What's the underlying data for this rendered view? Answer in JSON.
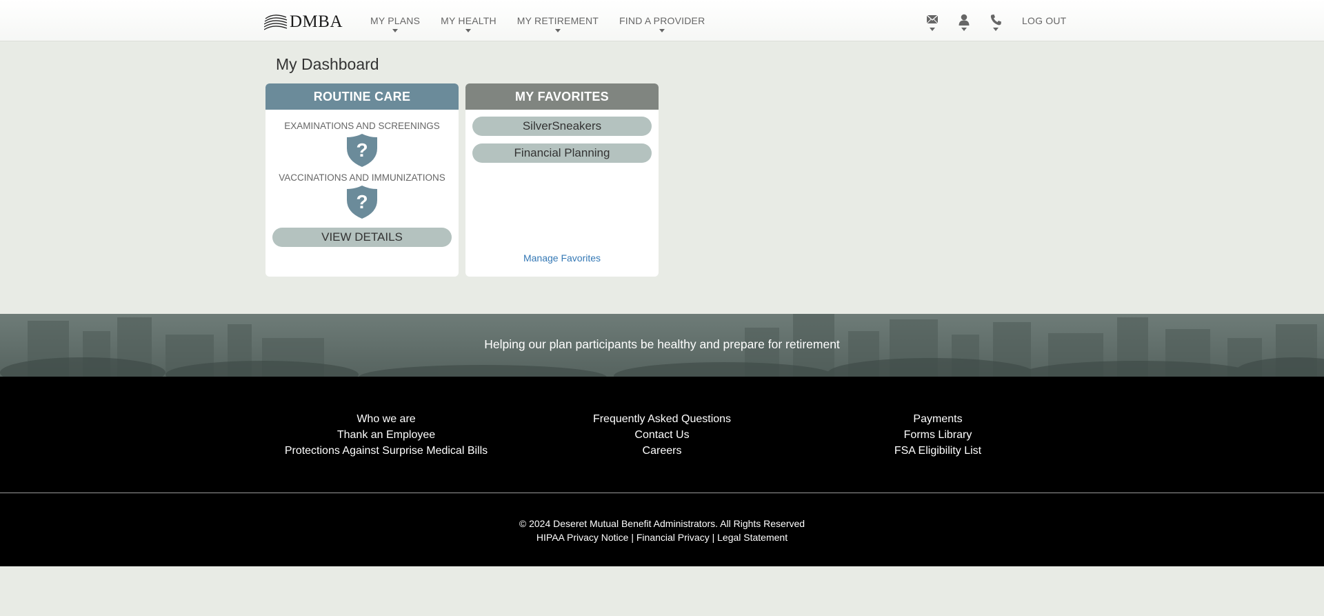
{
  "brand": {
    "name": "DMBA"
  },
  "nav": {
    "items": [
      {
        "label": "MY PLANS"
      },
      {
        "label": "MY HEALTH"
      },
      {
        "label": "MY RETIREMENT"
      },
      {
        "label": "FIND A PROVIDER"
      }
    ],
    "utilities": [
      "mail-icon",
      "user-icon",
      "phone-icon"
    ],
    "logout": "LOG OUT"
  },
  "main": {
    "title": "My Dashboard",
    "routine_care": {
      "heading": "ROUTINE CARE",
      "items": [
        {
          "label": "EXAMINATIONS AND SCREENINGS",
          "status_icon": "question-shield-icon"
        },
        {
          "label": "VACCINATIONS AND IMMUNIZATIONS",
          "status_icon": "question-shield-icon"
        }
      ],
      "button": "VIEW DETAILS"
    },
    "favorites": {
      "heading": "MY FAVORITES",
      "items": [
        {
          "label": "SilverSneakers"
        },
        {
          "label": "Financial Planning"
        }
      ],
      "manage_link": "Manage Favorites"
    }
  },
  "banner": {
    "tagline": "Helping our plan participants be healthy and prepare for retirement"
  },
  "footer": {
    "columns": [
      {
        "links": [
          "Who we are",
          "Thank an Employee",
          "Protections Against Surprise Medical Bills"
        ]
      },
      {
        "links": [
          "Frequently Asked Questions",
          "Contact Us",
          "Careers"
        ]
      },
      {
        "links": [
          "Payments",
          "Forms Library",
          "FSA Eligibility List"
        ]
      }
    ],
    "copyright": "© 2024 Deseret Mutual Benefit Administrators. All Rights Reserved",
    "legal": {
      "hipaa": "HIPAA Privacy Notice",
      "financial": "Financial Privacy",
      "statement": "Legal Statement",
      "separator": " | "
    }
  },
  "colors": {
    "page_bg": "#e8ebe5",
    "routine_header": "#6b8b9a",
    "favorites_header": "#808580",
    "pill_bg": "#b4c2bf",
    "link": "#3478b5",
    "footer_bg": "#000000"
  }
}
